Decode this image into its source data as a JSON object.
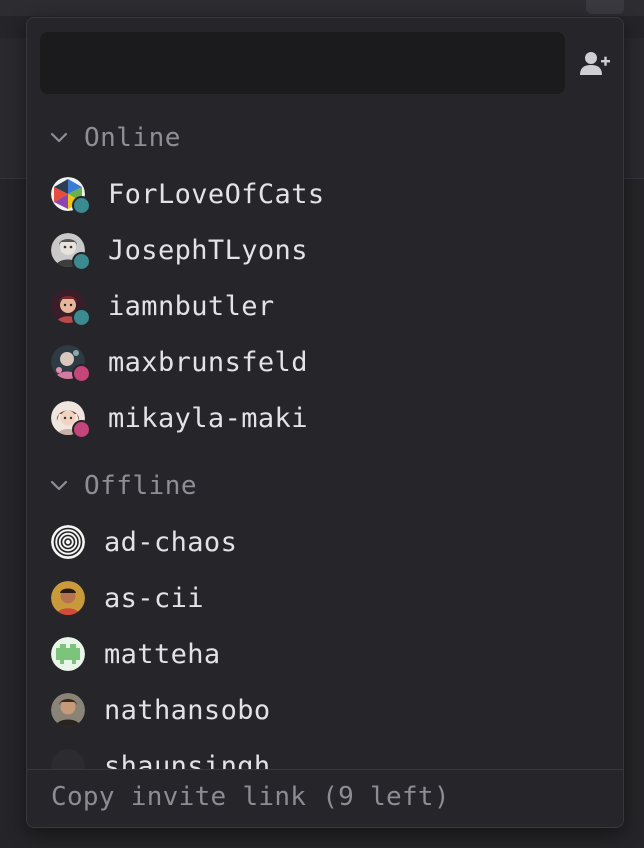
{
  "search": {
    "value": "",
    "placeholder": ""
  },
  "add_contact_icon": "add-user-icon",
  "sections": {
    "online": {
      "label": "Online",
      "contacts": [
        {
          "name": "ForLoveOfCats",
          "status_color": "#3b8a90"
        },
        {
          "name": "JosephTLyons",
          "status_color": "#3b8a90"
        },
        {
          "name": "iamnbutler",
          "status_color": "#3b8a90"
        },
        {
          "name": "maxbrunsfeld",
          "status_color": "#c4467b"
        },
        {
          "name": "mikayla-maki",
          "status_color": "#c4467b"
        }
      ]
    },
    "offline": {
      "label": "Offline",
      "contacts": [
        {
          "name": "ad-chaos"
        },
        {
          "name": "as-cii"
        },
        {
          "name": "matteha"
        },
        {
          "name": "nathansobo"
        },
        {
          "name": "shaunsingh"
        }
      ]
    }
  },
  "footer": {
    "invite_label": "Copy invite link (9 left)"
  },
  "colors": {
    "panel_bg": "#262529",
    "online": "#3b8a90",
    "busy": "#c4467b"
  }
}
